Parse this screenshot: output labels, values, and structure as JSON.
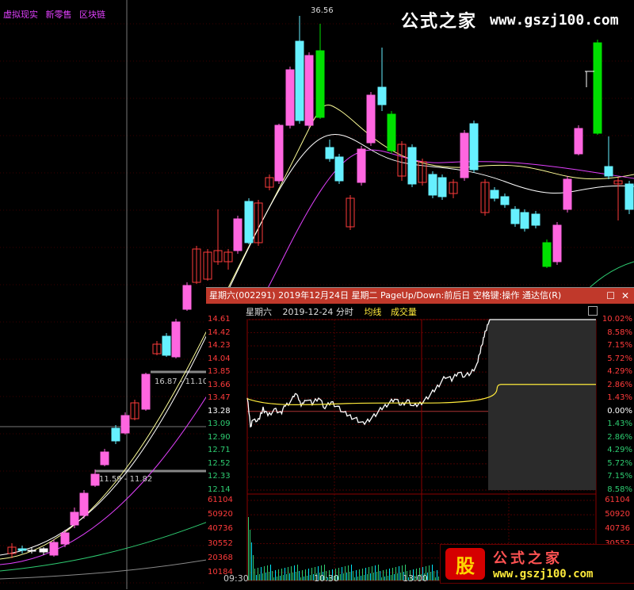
{
  "top_menu": [
    "虚拟现实",
    "新零售",
    "区块链"
  ],
  "watermark_top": {
    "cn": "公式之家",
    "url": "www.gszj100.com"
  },
  "peak_label": "36.56",
  "range_labels": [
    "16.87 - 11.10",
    "11.59 - 11.82"
  ],
  "popup": {
    "title": "星期六(002291) 2019年12月24日 星期二 PageUp/Down:前后日 空格键:操作 通达信(R)",
    "subhead_label": "星期六",
    "subhead_date": "2019-12-24 分时",
    "avg_label": "均线",
    "vol_label": "成交量",
    "price_labels": [
      "14.61",
      "14.42",
      "14.23",
      "14.04",
      "13.85",
      "13.66",
      "13.47",
      "13.28",
      "13.09",
      "12.90",
      "12.71",
      "12.52",
      "12.33",
      "12.14"
    ],
    "pct_labels": [
      "10.02%",
      "8.58%",
      "7.15%",
      "5.72%",
      "4.29%",
      "2.86%",
      "1.43%",
      "0.00%",
      "1.43%",
      "2.86%",
      "4.29%",
      "5.72%",
      "7.15%",
      "8.58%"
    ],
    "vol_labels": [
      "61104",
      "50920",
      "40736",
      "30552",
      "20368",
      "10184"
    ],
    "time_labels": [
      "09:30",
      "10:30",
      "13:00"
    ],
    "colors": {
      "up": "#ff3b3b",
      "down": "#00e5ff",
      "neutral": "#ffffff",
      "avg": "#ffeb3b"
    }
  },
  "watermark_bottom": {
    "logo": "股",
    "cn": "公式之家",
    "url": "www.gszj100.com"
  }
}
